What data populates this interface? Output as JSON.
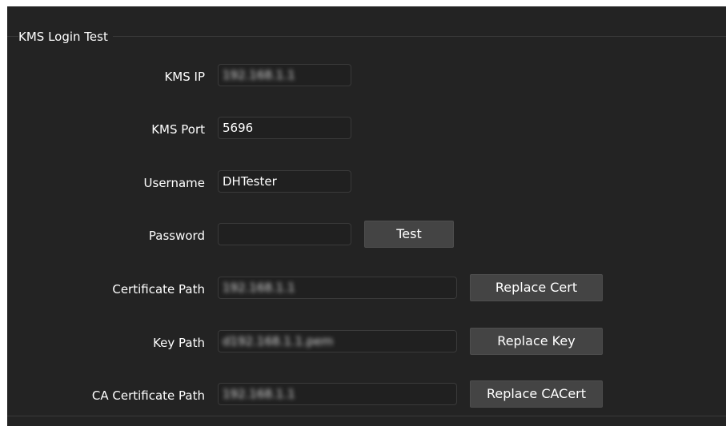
{
  "group": {
    "title": "KMS Login Test"
  },
  "fields": {
    "kms_ip": {
      "label": "KMS IP",
      "value": "192.168.1.1"
    },
    "kms_port": {
      "label": "KMS Port",
      "value": "5696"
    },
    "username": {
      "label": "Username",
      "value": "DHTester"
    },
    "password": {
      "label": "Password",
      "value": ""
    },
    "cert_path": {
      "label": "Certificate Path",
      "value": "192.168.1.1"
    },
    "key_path": {
      "label": "Key Path",
      "value": "d192.168.1.1.pem"
    },
    "ca_cert_path": {
      "label": "CA Certificate Path",
      "value": "192.168.1.1"
    }
  },
  "buttons": {
    "test": "Test",
    "replace_cert": "Replace Cert",
    "replace_key": "Replace Key",
    "replace_cacert": "Replace CACert"
  },
  "colors": {
    "panel_bg": "#232323",
    "button_bg": "#444444",
    "text": "#ffffff"
  }
}
